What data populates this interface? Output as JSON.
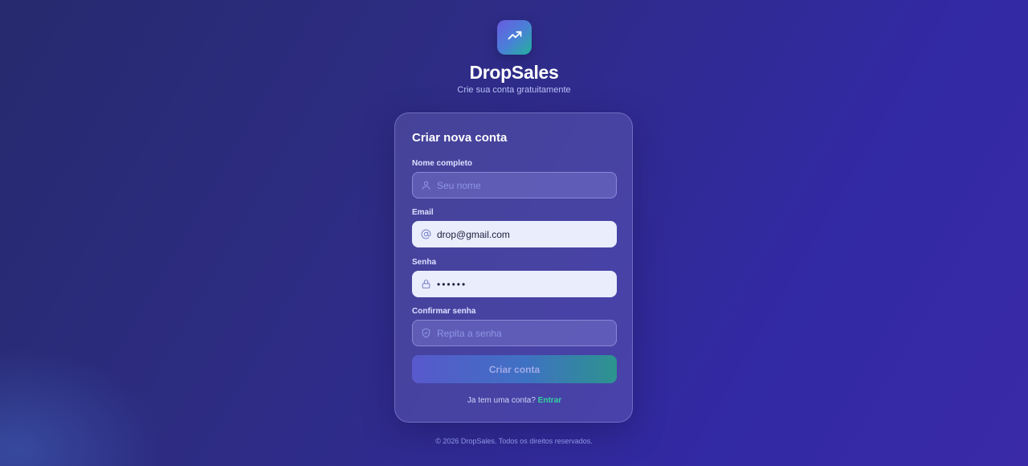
{
  "brand": {
    "name": "DropSales",
    "tagline": "Crie sua conta gratuitamente",
    "logo_icon": "trending-up-icon"
  },
  "form": {
    "title": "Criar nova conta",
    "fields": {
      "name": {
        "label": "Nome completo",
        "placeholder": "Seu nome",
        "value": "",
        "icon": "user-icon"
      },
      "email": {
        "label": "Email",
        "placeholder": "",
        "value": "drop@gmail.com",
        "icon": "at-sign-icon"
      },
      "password": {
        "label": "Senha",
        "placeholder": "",
        "value": "••••••",
        "icon": "lock-icon"
      },
      "confirm": {
        "label": "Confirmar senha",
        "placeholder": "Repita a senha",
        "value": "",
        "icon": "shield-icon"
      }
    },
    "submit_label": "Criar conta",
    "login_prompt": "Ja tem uma conta?",
    "login_link": "Entrar"
  },
  "footer": {
    "copyright": "© 2026 DropSales. Todos os direitos reservados."
  },
  "colors": {
    "accent_green": "#33d3a0",
    "brand_purple": "#5a5bd0",
    "background": "#2e2c86"
  }
}
